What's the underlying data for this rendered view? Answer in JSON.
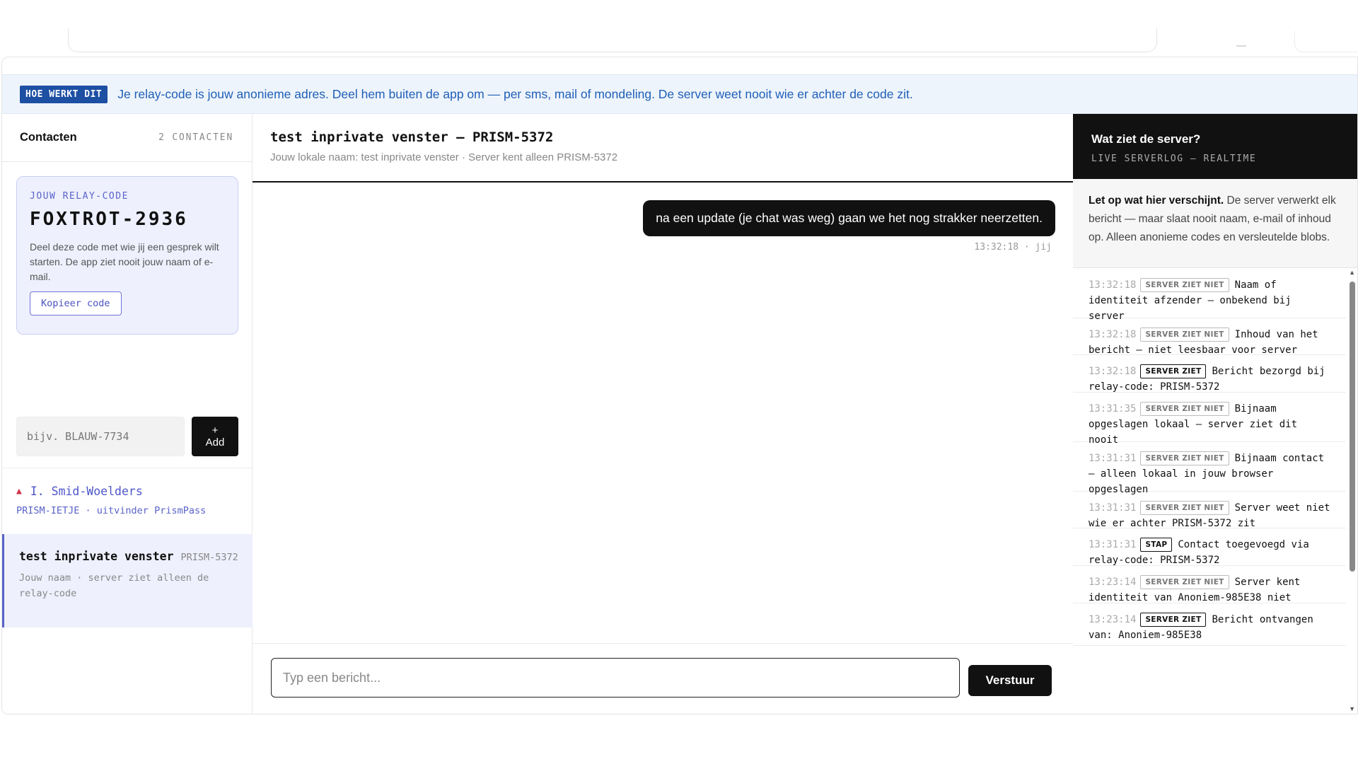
{
  "banner": {
    "tag": "HOE WERKT DIT",
    "text": "Je relay-code is jouw anonieme adres. Deel hem buiten de app om — per sms, mail of mondeling. De server weet nooit wie er achter de code zit."
  },
  "sidebar": {
    "title": "Contacten",
    "count": "2 CONTACTEN",
    "relay": {
      "label": "JOUW RELAY-CODE",
      "code": "FOXTROT-2936",
      "description": "Deel deze code met wie jij een gesprek wilt starten. De app ziet nooit jouw naam of e-mail.",
      "copy_label": "Kopieer code"
    },
    "add": {
      "placeholder": "bijv. BLAUW-7734",
      "plus": "+",
      "label": "Add"
    },
    "contacts": [
      {
        "warn_icon": "▲",
        "name": "I. Smid-Woelders",
        "sub": "PRISM-IETJE · uitvinder PrismPass"
      },
      {
        "name": "test inprivate venster",
        "code": "PRISM-5372",
        "sub": "Jouw naam · server ziet alleen de relay-code"
      }
    ]
  },
  "chat": {
    "title": "test inprivate venster — PRISM-5372",
    "subtitle": "Jouw lokale naam: test inprivate venster · Server kent alleen PRISM-5372",
    "messages": [
      {
        "text": "na een update (je chat was weg) gaan we het nog strakker neerzetten.",
        "meta": "13:32:18 · jij"
      }
    ],
    "input_placeholder": "Typ een bericht...",
    "send_label": "Verstuur"
  },
  "server": {
    "title": "Wat ziet de server?",
    "subtitle": "LIVE SERVERLOG — REALTIME",
    "note_bold": "Let op wat hier verschijnt.",
    "note_text": " De server verwerkt elk bericht — maar slaat nooit naam, e-mail of inhoud op. Alleen anonieme codes en versleutelde blobs.",
    "log": [
      {
        "time": "13:32:18",
        "tag": "SERVER ZIET NIET",
        "kind": "niet",
        "text": "Naam of identiteit afzender — onbekend bij server"
      },
      {
        "time": "13:32:18",
        "tag": "SERVER ZIET NIET",
        "kind": "niet",
        "text": "Inhoud van het bericht — niet leesbaar voor server"
      },
      {
        "time": "13:32:18",
        "tag": "SERVER ZIET",
        "kind": "ziet",
        "text": "Bericht bezorgd bij relay-code: PRISM-5372"
      },
      {
        "time": "13:31:35",
        "tag": "SERVER ZIET NIET",
        "kind": "niet",
        "text": "Bijnaam opgeslagen lokaal — server ziet dit nooit"
      },
      {
        "time": "13:31:31",
        "tag": "SERVER ZIET NIET",
        "kind": "niet",
        "text": "Bijnaam contact — alleen lokaal in jouw browser opgeslagen"
      },
      {
        "time": "13:31:31",
        "tag": "SERVER ZIET NIET",
        "kind": "niet",
        "text": "Server weet niet wie er achter PRISM-5372 zit"
      },
      {
        "time": "13:31:31",
        "tag": "STAP",
        "kind": "stap",
        "text": "Contact toegevoegd via relay-code: PRISM-5372"
      },
      {
        "time": "13:23:14",
        "tag": "SERVER ZIET NIET",
        "kind": "niet",
        "text": "Server kent identiteit van Anoniem-985E38 niet"
      },
      {
        "time": "13:23:14",
        "tag": "SERVER ZIET",
        "kind": "ziet",
        "text": "Bericht ontvangen van: Anoniem-985E38"
      }
    ]
  }
}
